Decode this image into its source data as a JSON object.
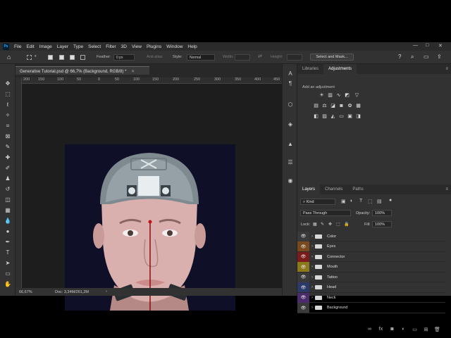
{
  "menubar": {
    "logo": "Ps",
    "items": [
      "File",
      "Edit",
      "Image",
      "Layer",
      "Type",
      "Select",
      "Filter",
      "3D",
      "View",
      "Plugins",
      "Window",
      "Help"
    ],
    "controls": [
      "—",
      "□",
      "✕"
    ]
  },
  "options": {
    "feather_label": "Feather:",
    "feather_value": "0 px",
    "antialias_label": "Anti-alias",
    "style_label": "Style:",
    "style_value": "Normal",
    "width_label": "Width:",
    "height_label": "Height:",
    "select_mask_button": "Select and Mask..."
  },
  "document": {
    "tab_title": "Generative Tutorial.psd @ 66,7% (Background, RGB/8) *",
    "tab_close": "✕",
    "ruler_ticks": [
      "200",
      "150",
      "100",
      "50",
      "0",
      "50",
      "100",
      "150",
      "200",
      "250",
      "300",
      "350",
      "400",
      "450",
      "500",
      "550",
      "600",
      "650",
      "700",
      "750",
      "800",
      "850"
    ],
    "zoom": "66,67%",
    "doc_info": "Doc: 3,34M/261,2M",
    "status_arrow": "›"
  },
  "panels": {
    "top_tabs": [
      "Libraries",
      "Adjustments"
    ],
    "active_top_tab": "Adjustments",
    "add_adjustment": "Add an adjustment",
    "layer_tabs": [
      "Layers",
      "Channels",
      "Paths"
    ],
    "active_layer_tab": "Layers",
    "kind_filter": "Kind",
    "blend_mode": "Pass Through",
    "opacity_label": "Opacity:",
    "opacity_value": "100%",
    "lock_label": "Lock:",
    "fill_label": "Fill:",
    "fill_value": "100%",
    "layers": [
      {
        "name": "Color",
        "color": "#3a3a3a"
      },
      {
        "name": "Eyes",
        "color": "#7a4a1e"
      },
      {
        "name": "Connector",
        "color": "#7a1c1c"
      },
      {
        "name": "Mouth",
        "color": "#8a7a1c"
      },
      {
        "name": "Tattoo",
        "color": "#3a3a3a"
      },
      {
        "name": "Head",
        "color": "#2c3a6a"
      },
      {
        "name": "Neck",
        "color": "#4a2c6a"
      },
      {
        "name": "Background",
        "color": "#3a3a3a"
      }
    ]
  }
}
